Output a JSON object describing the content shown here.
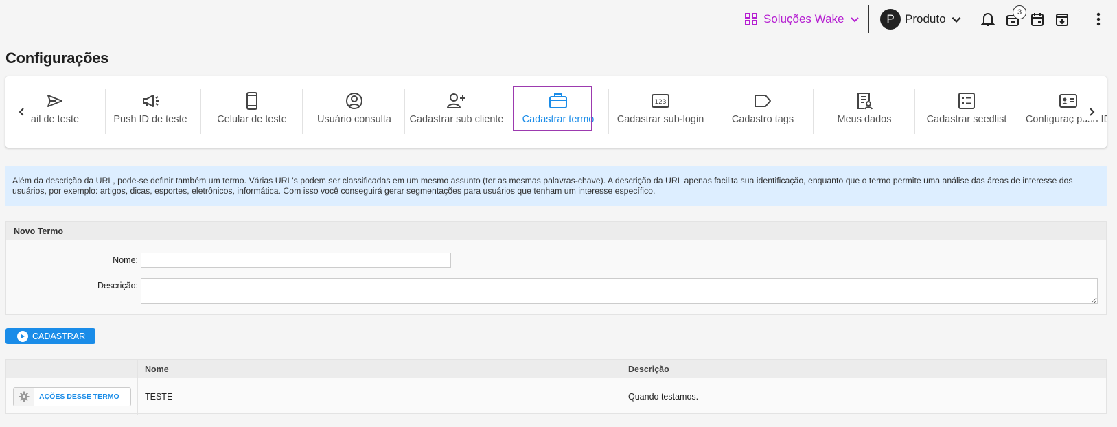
{
  "header": {
    "solutions_label": "Soluções Wake",
    "avatar_letter": "P",
    "account_label": "Produto",
    "notification_badge": "3",
    "colors": {
      "accent": "#b51ed1"
    }
  },
  "page": {
    "title": "Configurações"
  },
  "carousel": {
    "items": [
      {
        "label": "ail de teste",
        "icon": "send-icon"
      },
      {
        "label": "Push ID de teste",
        "icon": "megaphone-icon"
      },
      {
        "label": "Celular de teste",
        "icon": "phone-icon"
      },
      {
        "label": "Usuário consulta",
        "icon": "user-circle-icon"
      },
      {
        "label": "Cadastrar sub cliente",
        "icon": "add-user-icon"
      },
      {
        "label": "Cadastrar termo",
        "icon": "briefcase-icon",
        "active": true
      },
      {
        "label": "Cadastrar sub-login",
        "icon": "numeric-icon"
      },
      {
        "label": "Cadastro tags",
        "icon": "tag-icon"
      },
      {
        "label": "Meus dados",
        "icon": "profile-doc-icon"
      },
      {
        "label": "Cadastrar seedlist",
        "icon": "checklist-icon"
      },
      {
        "label": "Configuraç push ID",
        "icon": "id-card-icon"
      }
    ],
    "active_color": "#1a8ce8",
    "highlight_color": "#9c3aaf"
  },
  "info": {
    "text": "Além da descrição da URL, pode-se definir também um termo. Várias URL's podem ser classificadas em um mesmo assunto (ter as mesmas palavras-chave). A descrição da URL apenas facilita sua identificação, enquanto que o termo permite uma análise das áreas de interesse dos usuários, por exemplo: artigos, dicas, esportes, eletrônicos, informática. Com isso você conseguirá gerar segmentações para usuários que tenham um interesse específico."
  },
  "form": {
    "title": "Novo Termo",
    "name_label": "Nome:",
    "name_value": "",
    "description_label": "Descrição:",
    "description_value": "",
    "submit_label": "CADASTRAR"
  },
  "table": {
    "columns": [
      "",
      "Nome",
      "Descrição"
    ],
    "rows": [
      {
        "actions_label": "AÇÕES DESSE TERMO",
        "name": "TESTE",
        "description": "Quando testamos."
      }
    ]
  }
}
